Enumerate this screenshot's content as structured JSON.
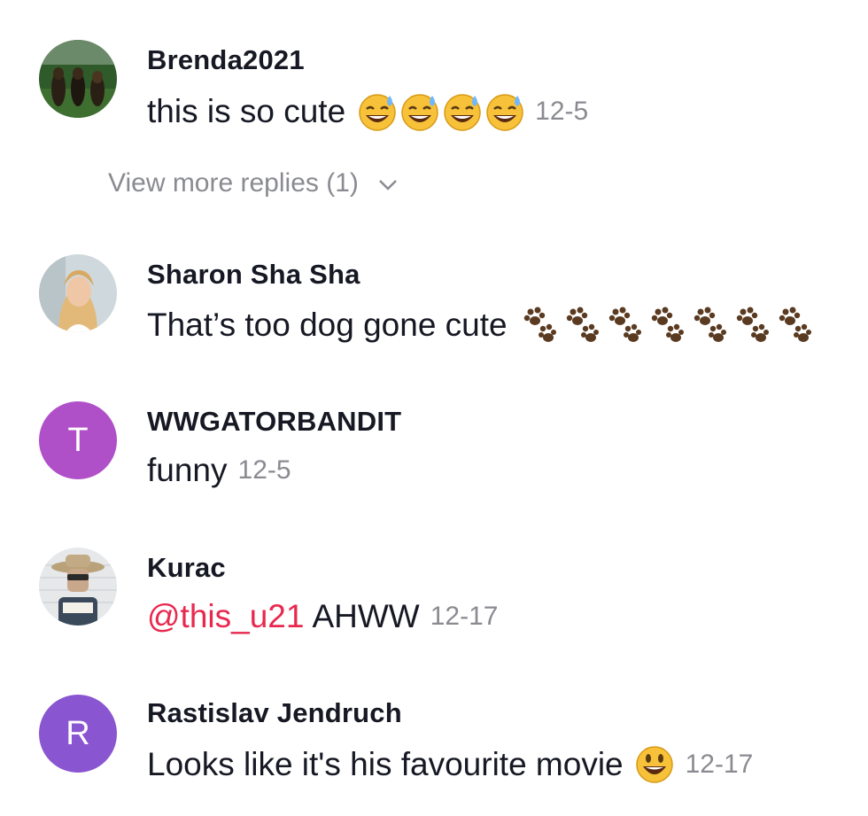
{
  "comments": [
    {
      "username": "Brenda2021",
      "text": "this is so cute",
      "emoji": "grinning-sweat-emoji x4",
      "time": "12-5",
      "replies_label": "View more replies (1)"
    },
    {
      "username": "Sharon Sha Sha",
      "text": "That’s too dog gone cute",
      "emoji": "paw-prints-emoji x7"
    },
    {
      "username": "WWGATORBANDIT",
      "avatar_letter": "T",
      "text": "funny",
      "time": "12-5"
    },
    {
      "username": "Kurac",
      "mention": "@this_u21",
      "text": "AHWW",
      "time": "12-17"
    },
    {
      "username": "Rastislav Jendruch",
      "avatar_letter": "R",
      "text": "Looks like it's his favourite movie",
      "emoji": "grinning-face-emoji",
      "time": "12-17"
    }
  ],
  "colors": {
    "username": "#161823",
    "timestamp": "#8a8b91",
    "mention": "#e8284f",
    "avatar_t": "#b050c8",
    "avatar_r": "#8a55d0"
  }
}
